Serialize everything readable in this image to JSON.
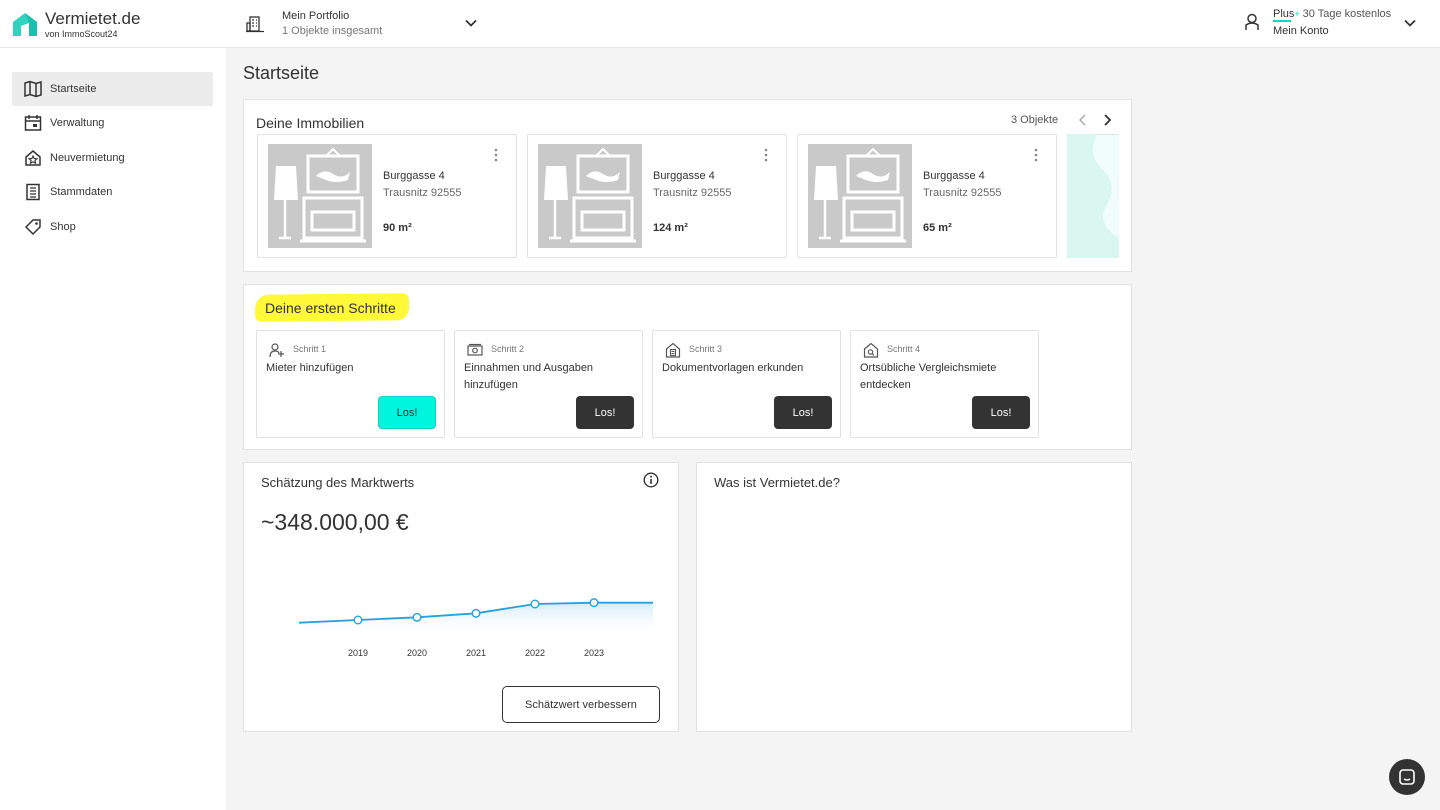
{
  "header": {
    "logo": {
      "title": "Vermietet.de",
      "subtitle": "von ImmoScout24"
    },
    "portfolio": {
      "title": "Mein Portfolio",
      "subtitle": "1 Objekte insgesamt"
    },
    "account": {
      "plan": "Plus",
      "plan_mark": "+",
      "trial": "30 Tage kostenlos",
      "label": "Mein Konto"
    }
  },
  "sidebar": {
    "items": [
      {
        "label": "Startseite",
        "icon": "map-icon",
        "active": true
      },
      {
        "label": "Verwaltung",
        "icon": "calendar-icon",
        "active": false
      },
      {
        "label": "Neuvermietung",
        "icon": "house-star-icon",
        "active": false
      },
      {
        "label": "Stammdaten",
        "icon": "building-list-icon",
        "active": false
      },
      {
        "label": "Shop",
        "icon": "tag-icon",
        "active": false
      }
    ]
  },
  "page": {
    "title": "Startseite"
  },
  "properties": {
    "title": "Deine Immobilien",
    "count": "3 Objekte",
    "items": [
      {
        "address": "Burggasse 4",
        "city": "Trausnitz 92555",
        "area": "90 m²"
      },
      {
        "address": "Burggasse 4",
        "city": "Trausnitz 92555",
        "area": "124 m²"
      },
      {
        "address": "Burggasse 4",
        "city": "Trausnitz 92555",
        "area": "65 m²"
      }
    ]
  },
  "steps": {
    "title": "Deine ersten Schritte",
    "items": [
      {
        "num": "Schritt 1",
        "title": "Mieter hinzufügen",
        "button": "Los!",
        "icon": "add-person-icon",
        "primary": true
      },
      {
        "num": "Schritt 2",
        "title": "Einnahmen und Ausgaben hinzufügen",
        "button": "Los!",
        "icon": "money-icon",
        "primary": false
      },
      {
        "num": "Schritt 3",
        "title": "Dokumentvorlagen erkunden",
        "button": "Los!",
        "icon": "house-document-icon",
        "primary": false
      },
      {
        "num": "Schritt 4",
        "title": "Ortsübliche Vergleichsmiete entdecken",
        "button": "Los!",
        "icon": "house-search-icon",
        "primary": false
      }
    ]
  },
  "market_value": {
    "title": "Schätzung des Marktwerts",
    "value": "~348.000,00 €",
    "button": "Schätzwert verbessern"
  },
  "what_is": {
    "title": "Was ist Vermietet.de?"
  },
  "chart_data": {
    "type": "area",
    "x": [
      2019,
      2020,
      2021,
      2022,
      2023
    ],
    "values": [
      0.85,
      0.86,
      0.875,
      0.91,
      0.915
    ],
    "line_start": 0.84,
    "line_end": 0.915,
    "colors": {
      "line": "#2a9fd8",
      "point_fill": "#ffffff"
    }
  },
  "colors": {
    "accent": "#00f5de",
    "highlight": "#fff93a",
    "dark": "#333333"
  }
}
